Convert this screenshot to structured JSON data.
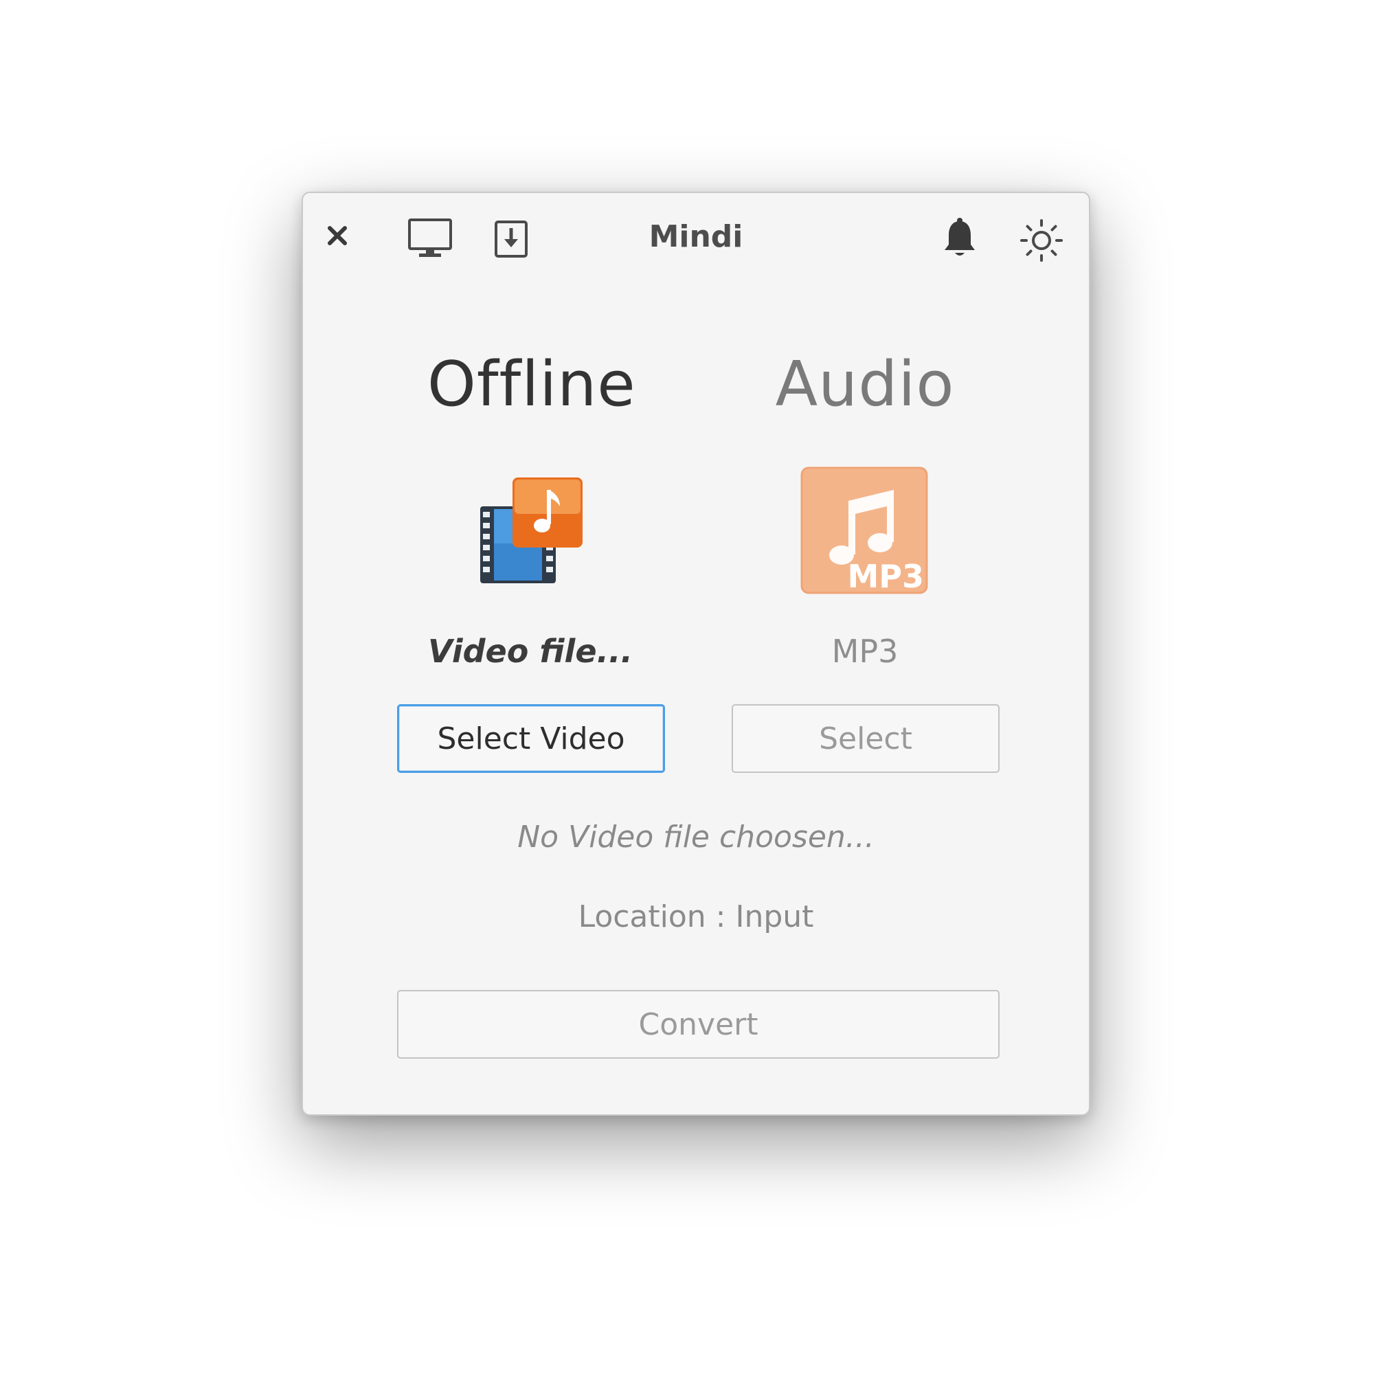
{
  "window": {
    "title": "Mindi"
  },
  "toolbar": {
    "icons": [
      "close-icon",
      "monitor-icon",
      "download-icon",
      "bell-icon",
      "brightness-icon"
    ]
  },
  "modes": {
    "left_heading": "Offline",
    "right_heading": "Audio"
  },
  "source": {
    "label": "Video file...",
    "button_label": "Select Video",
    "icon": "video-audio-icon"
  },
  "format": {
    "label": "MP3",
    "button_label": "Select",
    "icon": "mp3-icon",
    "icon_text": "MP3"
  },
  "status": {
    "message": "No Video file choosen...",
    "location": "Location : Input"
  },
  "actions": {
    "convert_label": "Convert"
  },
  "colors": {
    "accent_focus": "#4a9ee8",
    "orange": "#f07c2a",
    "blue_film": "#3d8fd6",
    "mp3_faded": "#f6b58c"
  }
}
